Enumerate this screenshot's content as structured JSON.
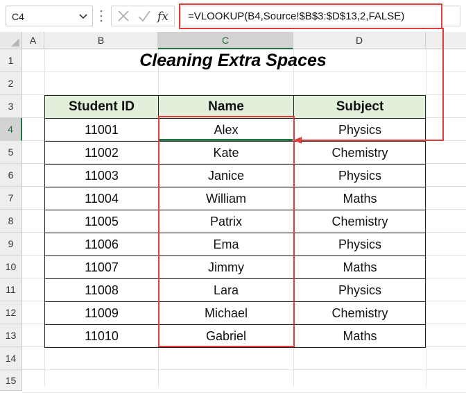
{
  "formula_bar": {
    "name_box": "C4",
    "formula": "=VLOOKUP(B4,Source!$B$3:$D$13,2,FALSE)",
    "fx_label": "fx",
    "icons": [
      "chevron-down-icon",
      "cancel-x-icon",
      "enter-check-icon",
      "insert-function-icon"
    ]
  },
  "columns": [
    "A",
    "B",
    "C",
    "D"
  ],
  "active_column": "C",
  "rows": [
    "1",
    "2",
    "3",
    "4",
    "5",
    "6",
    "7",
    "8",
    "9",
    "10",
    "11",
    "12",
    "13",
    "14",
    "15"
  ],
  "active_row": "4",
  "title": "Cleaning Extra Spaces",
  "table": {
    "headers": [
      "Student ID",
      "Name",
      "Subject"
    ],
    "rows": [
      [
        "11001",
        "Alex",
        "Physics"
      ],
      [
        "11002",
        "Kate",
        "Chemistry"
      ],
      [
        "11003",
        "Janice",
        "Physics"
      ],
      [
        "11004",
        "William",
        "Maths"
      ],
      [
        "11005",
        "Patrix",
        "Chemistry"
      ],
      [
        "11006",
        "Ema",
        "Physics"
      ],
      [
        "11007",
        "Jimmy",
        "Maths"
      ],
      [
        "11008",
        "Lara",
        "Physics"
      ],
      [
        "11009",
        "Michael",
        "Chemistry"
      ],
      [
        "11010",
        "Gabriel",
        "Maths"
      ]
    ]
  },
  "colors": {
    "header_fill": "#e2efda",
    "highlight": "#e23b3b",
    "excel_green": "#217346"
  }
}
